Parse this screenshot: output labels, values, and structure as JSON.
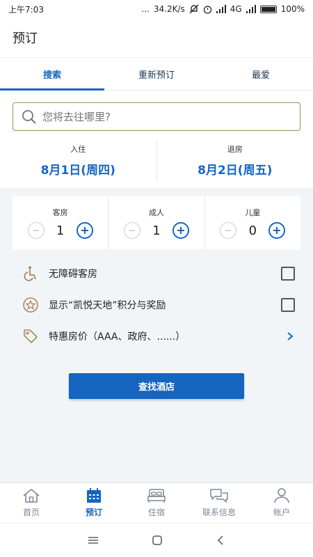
{
  "status_bar": {
    "time": "上午7:03",
    "dots": "...",
    "network_speed": "34.2K/s",
    "network_type": "4G",
    "battery": "100%"
  },
  "app_bar": {
    "title": "预订"
  },
  "tabs": [
    {
      "label": "搜索",
      "active": true
    },
    {
      "label": "重新预订",
      "active": false
    },
    {
      "label": "最爱",
      "active": false
    }
  ],
  "search": {
    "placeholder": "您将去往哪里?",
    "value": ""
  },
  "dates": {
    "check_in": {
      "label": "入住",
      "value": "8月1日(周四)"
    },
    "check_out": {
      "label": "退房",
      "value": "8月2日(周五)"
    }
  },
  "counters": {
    "rooms": {
      "label": "客房",
      "value": "1"
    },
    "adults": {
      "label": "成人",
      "value": "1"
    },
    "children": {
      "label": "儿童",
      "value": "0"
    }
  },
  "options": {
    "accessible": {
      "label": "无障碍客房",
      "icon": "wheelchair-icon"
    },
    "points": {
      "label": "显示“凯悦天地”积分与奖励",
      "icon": "star-badge-icon"
    },
    "special_rates": {
      "label": "特惠房价（AAA、政府、......）",
      "icon": "tag-icon"
    }
  },
  "find_button": {
    "label": "查找酒店"
  },
  "bottom_nav": [
    {
      "label": "首页",
      "icon": "home-icon",
      "active": false
    },
    {
      "label": "预订",
      "icon": "calendar-icon",
      "active": true
    },
    {
      "label": "住宿",
      "icon": "bed-icon",
      "active": false
    },
    {
      "label": "联系信息",
      "icon": "chat-icon",
      "active": false
    },
    {
      "label": "帐户",
      "icon": "person-icon",
      "active": false
    }
  ],
  "colors": {
    "accent": "#1565c0",
    "gold": "#a68a5b",
    "background": "#f2f5f8"
  }
}
